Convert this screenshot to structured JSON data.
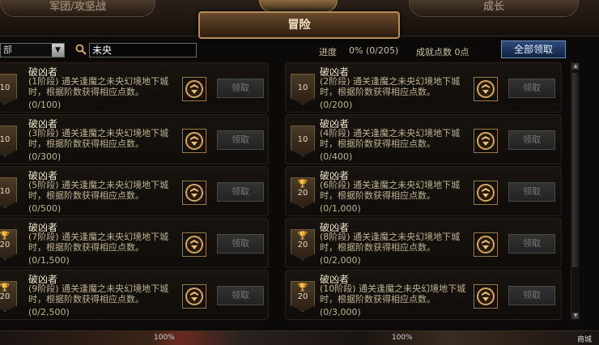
{
  "tabs": {
    "left": "军团/攻坚战",
    "center": "冒险",
    "right": "成长"
  },
  "filter": {
    "dropdown_value": "部"
  },
  "search": {
    "value": "未央"
  },
  "progress": {
    "label": "进度",
    "percent": "0%",
    "fraction": "(0/205)",
    "points": "成就点数 0点"
  },
  "claim_all": "全部领取",
  "cards": [
    {
      "title": "破凶者",
      "desc": "(1阶段) 通关逢魔之未央幻境地下城时，根据阶数获得相应点数。",
      "count": "(0/100)",
      "badge": "10",
      "cup": false,
      "claim": "领取"
    },
    {
      "title": "破凶者",
      "desc": "(2阶段) 通关逢魔之未央幻境地下城时，根据阶数获得相应点数。",
      "count": "(0/200)",
      "badge": "10",
      "cup": false,
      "claim": "领取"
    },
    {
      "title": "破凶者",
      "desc": "(3阶段) 通关逢魔之未央幻境地下城时，根据阶数获得相应点数。",
      "count": "(0/300)",
      "badge": "10",
      "cup": false,
      "claim": "领取"
    },
    {
      "title": "破凶者",
      "desc": "(4阶段) 通关逢魔之未央幻境地下城时，根据阶数获得相应点数。",
      "count": "(0/400)",
      "badge": "10",
      "cup": false,
      "claim": "领取"
    },
    {
      "title": "破凶者",
      "desc": "(5阶段) 通关逢魔之未央幻境地下城时，根据阶数获得相应点数。",
      "count": "(0/500)",
      "badge": "10",
      "cup": false,
      "claim": "领取"
    },
    {
      "title": "破凶者",
      "desc": "(6阶段) 通关逢魔之未央幻境地下城时，根据阶数获得相应点数。",
      "count": "(0/1,000)",
      "badge": "20",
      "cup": true,
      "claim": "领取"
    },
    {
      "title": "破凶者",
      "desc": "(7阶段) 通关逢魔之未央幻境地下城时，根据阶数获得相应点数。",
      "count": "(0/1,500)",
      "badge": "20",
      "cup": true,
      "claim": "领取"
    },
    {
      "title": "破凶者",
      "desc": "(8阶段) 通关逢魔之未央幻境地下城时，根据阶数获得相应点数。",
      "count": "(0/2,000)",
      "badge": "20",
      "cup": true,
      "claim": "领取"
    },
    {
      "title": "破凶者",
      "desc": "(9阶段) 通关逢魔之未央幻境地下城时，根据阶数获得相应点数。",
      "count": "(0/2,500)",
      "badge": "20",
      "cup": true,
      "claim": "领取"
    },
    {
      "title": "破凶者",
      "desc": "(10阶段) 通关逢魔之未央幻境地下城时，根据阶数获得相应点数。",
      "count": "(0/3,000)",
      "badge": "20",
      "cup": true,
      "claim": "领取"
    }
  ],
  "bottom": {
    "pct1": "100%",
    "pct2": "100%",
    "shop": "商城"
  }
}
